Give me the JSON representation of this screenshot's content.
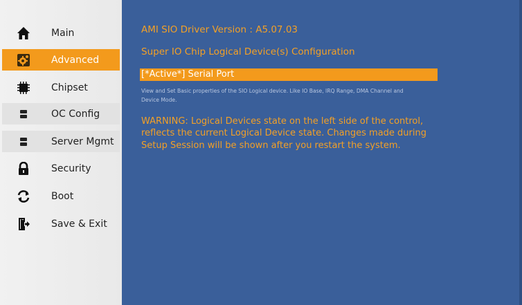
{
  "sidebar": {
    "items": [
      {
        "label": "Main",
        "icon": "home-icon",
        "active": false
      },
      {
        "label": "Advanced",
        "icon": "gear-icon",
        "active": true
      },
      {
        "label": "Chipset",
        "icon": "chip-icon",
        "active": false
      },
      {
        "label": "OC Config",
        "icon": "server-icon",
        "active": false
      },
      {
        "label": "Server Mgmt",
        "icon": "server-icon",
        "active": false
      },
      {
        "label": "Security",
        "icon": "lock-icon",
        "active": false
      },
      {
        "label": "Boot",
        "icon": "refresh-icon",
        "active": false
      },
      {
        "label": "Save & Exit",
        "icon": "exit-door-icon",
        "active": false
      }
    ]
  },
  "main": {
    "driver_version": "AMI SIO Driver Version :  A5.07.03",
    "section_title": "Super IO Chip Logical Device(s) Configuration",
    "selected_item": "[*Active*]  Serial Port",
    "help_text": "View and Set Basic properties of the SIO Logical device. Like IO Base, IRQ Range, DMA Channel and Device Mode.",
    "warning_text": "WARNING: Logical Devices state on the left side of the control, reflects the current Logical Device state. Changes made during Setup Session will be shown after you restart the system."
  },
  "colors": {
    "accent": "#f39a1c",
    "main_bg": "#3a5f9a",
    "sidebar_bg": "#efefef",
    "warning_text": "#f3a026"
  }
}
